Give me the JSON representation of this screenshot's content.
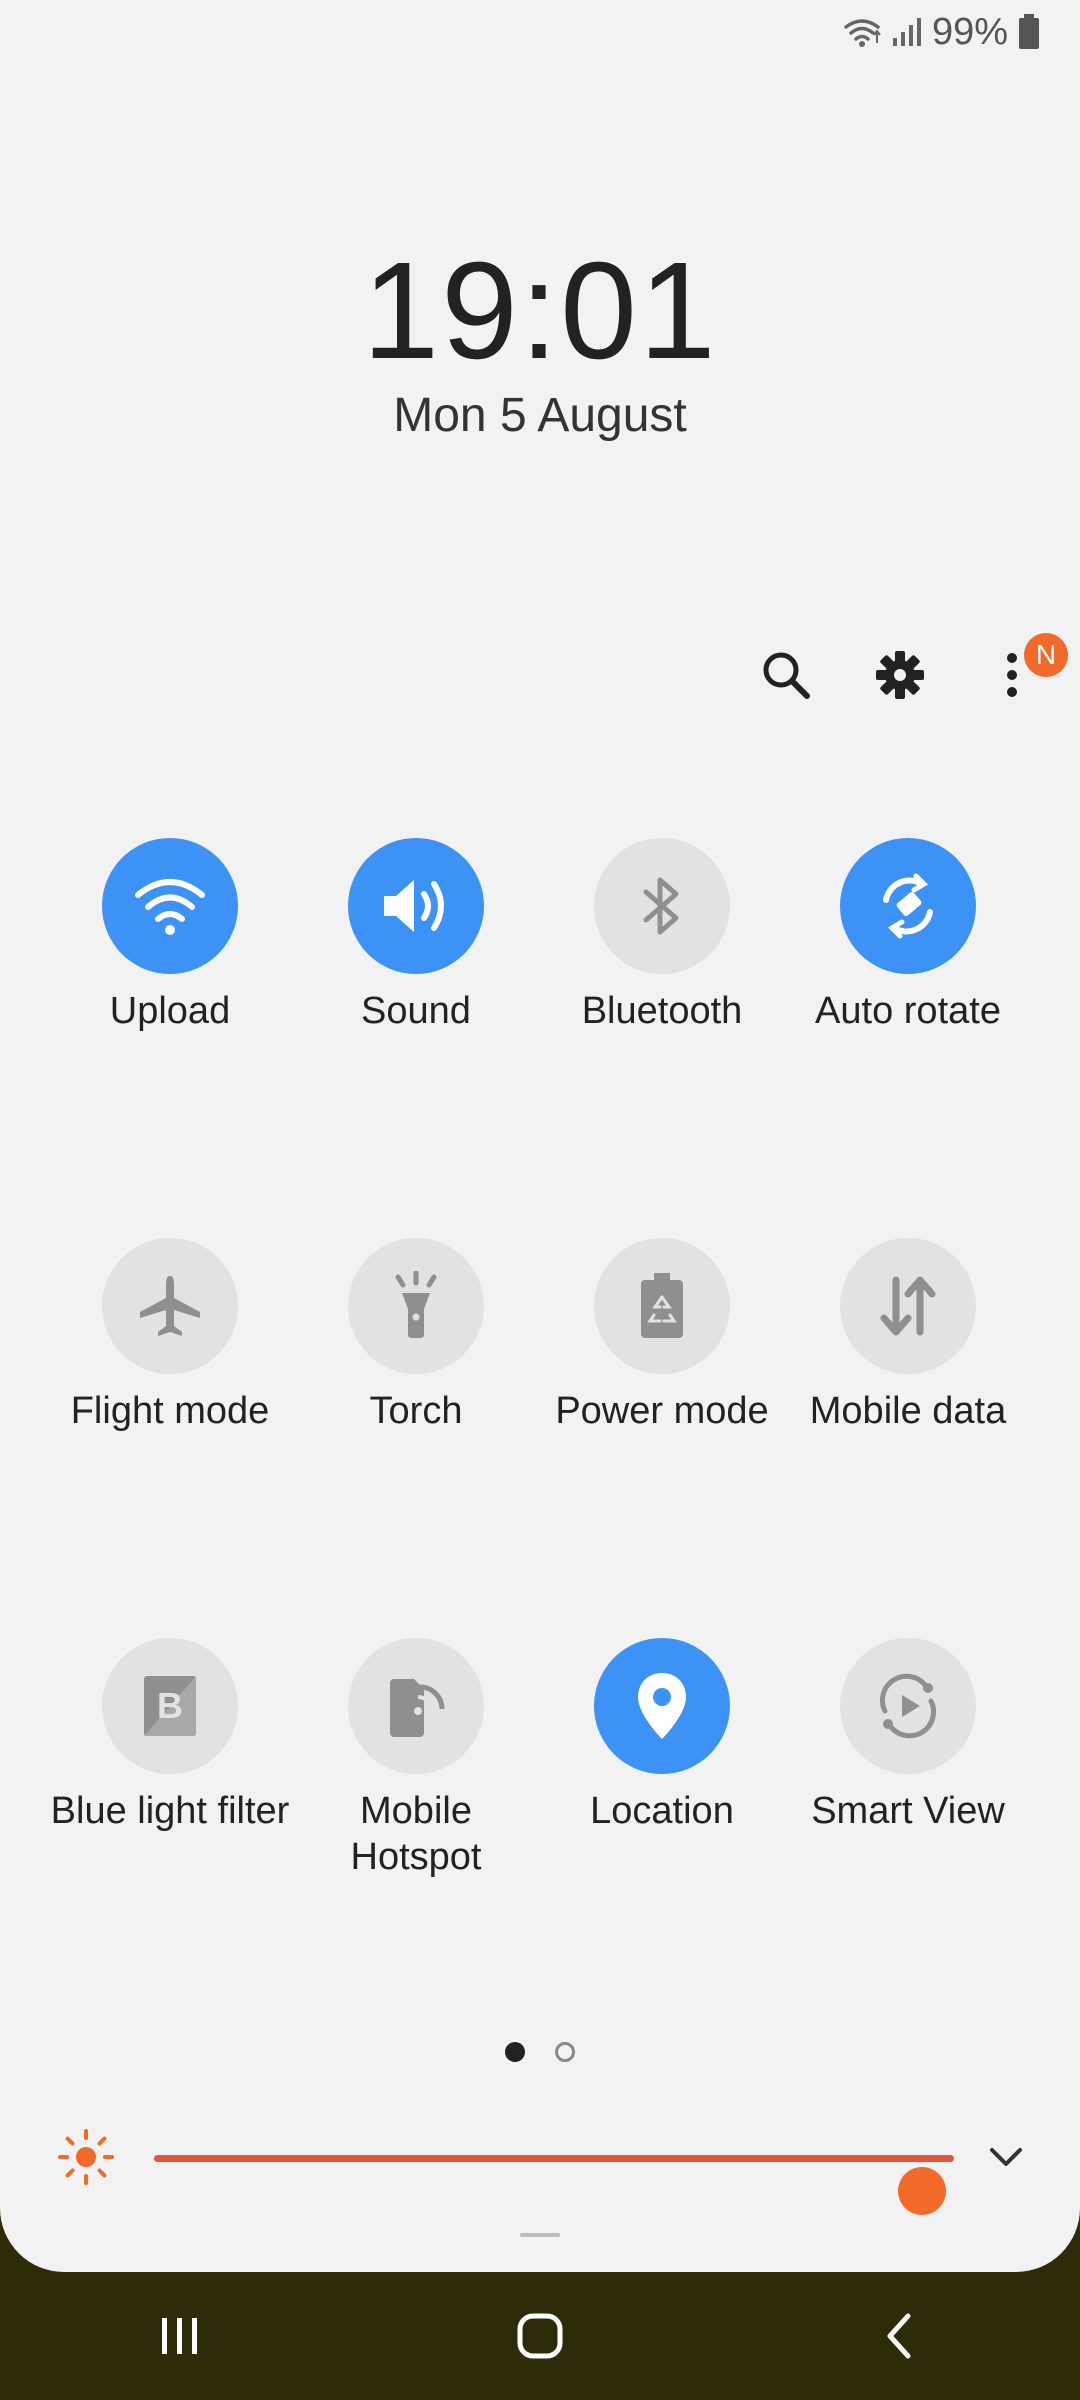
{
  "status_bar": {
    "battery": "99%"
  },
  "lock": {
    "time": "19:01",
    "date": "Mon 5 August"
  },
  "top_actions": {
    "notification_badge": "N"
  },
  "tiles": [
    {
      "label": "Upload",
      "icon": "wifi-icon",
      "on": true
    },
    {
      "label": "Sound",
      "icon": "sound-icon",
      "on": true
    },
    {
      "label": "Bluetooth",
      "icon": "bluetooth-icon",
      "on": false
    },
    {
      "label": "Auto rotate",
      "icon": "auto-rotate-icon",
      "on": true
    },
    {
      "label": "Flight mode",
      "icon": "airplane-icon",
      "on": false
    },
    {
      "label": "Torch",
      "icon": "torch-icon",
      "on": false
    },
    {
      "label": "Power mode",
      "icon": "power-mode-icon",
      "on": false
    },
    {
      "label": "Mobile data",
      "icon": "mobile-data-icon",
      "on": false
    },
    {
      "label": "Blue light filter",
      "icon": "blue-light-filter-icon",
      "on": false
    },
    {
      "label": "Mobile Hotspot",
      "icon": "hotspot-icon",
      "on": false
    },
    {
      "label": "Location",
      "icon": "location-icon",
      "on": true
    },
    {
      "label": "Smart View",
      "icon": "smart-view-icon",
      "on": false
    }
  ],
  "pager": {
    "pages": 2,
    "current": 1
  },
  "brightness": {
    "level": 0.96
  },
  "colors": {
    "accent_on": "#3d93f5",
    "tile_off": "#e2e2e2",
    "brightness": "#f26a2a"
  }
}
